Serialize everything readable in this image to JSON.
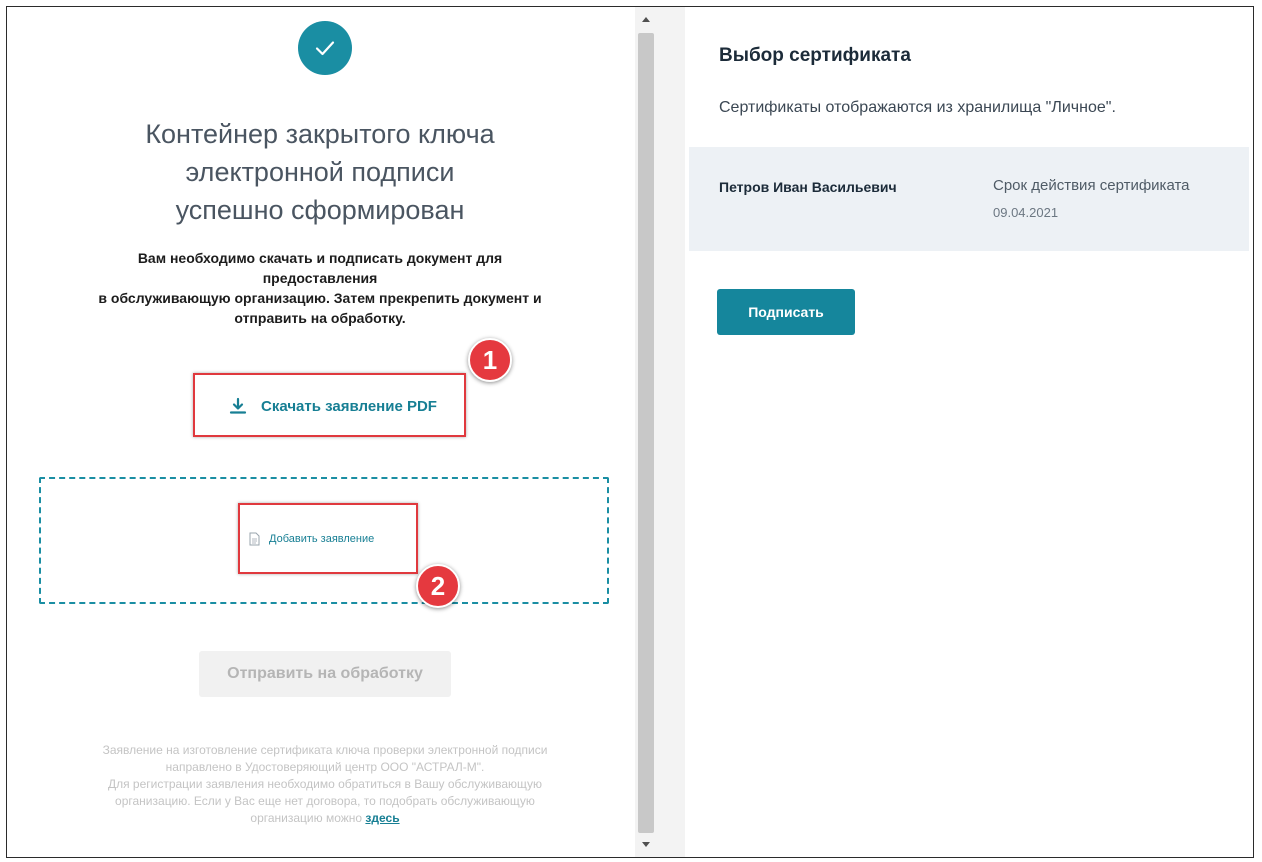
{
  "left_panel": {
    "success_icon": "check-icon",
    "title_lines": [
      "Контейнер закрытого ключа",
      "электронной подписи",
      "успешно сформирован"
    ],
    "instruction_lines": [
      "Вам необходимо скачать и подписать документ для",
      "предоставления",
      "в обслуживающую организацию. Затем прекрепить документ и",
      "отправить на обработку."
    ],
    "download_link": {
      "icon": "download-icon",
      "label": "Скачать заявление PDF"
    },
    "drop_zone": {
      "icon": "document-icon",
      "label": "Добавить заявление"
    },
    "send_button": "Отправить на обработку",
    "footnote": {
      "lines": [
        "Заявление на изготовление сертификата ключа проверки электронной подписи",
        "направлено в Удостоверяющий центр ООО \"АСТРАЛ-М\".",
        "Для регистрации заявления необходимо обратиться в Вашу обслуживающую",
        "организацию. Если у Вас еще нет договора, то подобрать обслуживающую"
      ],
      "last_line_prefix": "организацию можно ",
      "link_text": "здесь"
    }
  },
  "annotations": {
    "badge_1": "1",
    "badge_2": "2"
  },
  "right_panel": {
    "title": "Выбор сертификата",
    "subtitle": "Сертификаты отображаются из хранилища \"Личное\".",
    "certificate": {
      "owner": "Петров Иван Васильевич",
      "validity_label": "Срок действия сертификата",
      "validity_date": "09.04.2021"
    },
    "sign_button": "Подписать"
  },
  "colors": {
    "accent": "#1a8ea3",
    "annotation_red": "#e5393f",
    "cert_row_bg": "#edf1f5",
    "disabled_text": "#b5b5b5"
  }
}
